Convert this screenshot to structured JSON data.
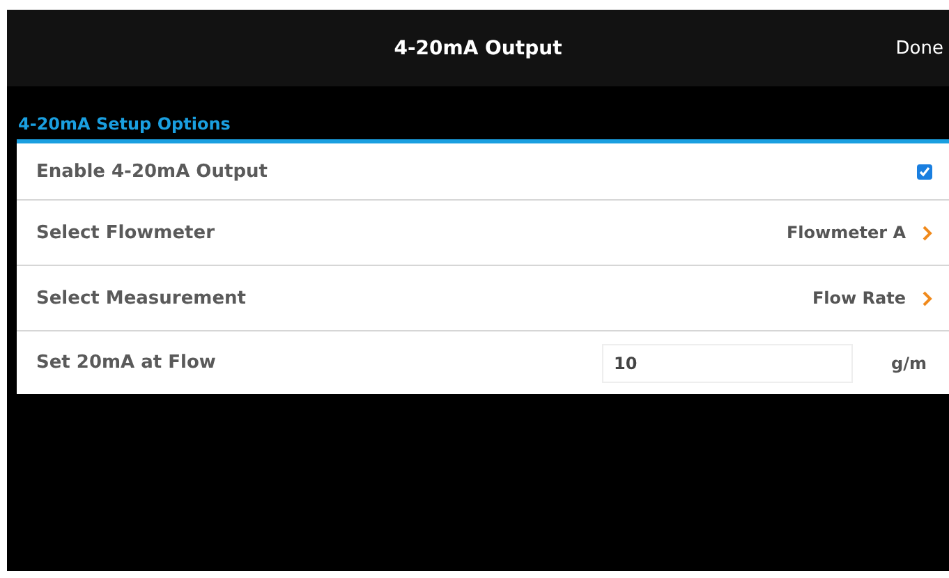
{
  "nav_bar": {
    "title": "4-20mA Output",
    "done_button": "Done"
  },
  "section": {
    "header": "4-20mA Setup Options",
    "rows": [
      {
        "kind": "checkbox",
        "label": "Enable 4-20mA Output",
        "checked": true
      },
      {
        "kind": "link",
        "label": "Select Flowmeter",
        "value": "Flowmeter A"
      },
      {
        "kind": "link",
        "label": "Select Measurement",
        "value": "Flow Rate"
      },
      {
        "kind": "input",
        "label": "Set 20mA at Flow",
        "value": "10",
        "unit": "g/m"
      }
    ]
  }
}
